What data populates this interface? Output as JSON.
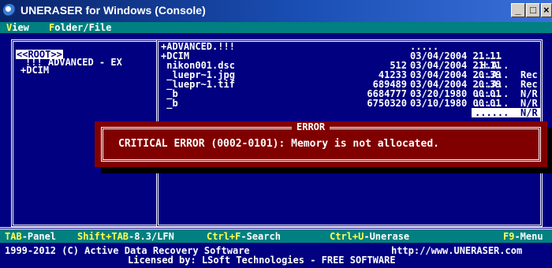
{
  "window": {
    "title": "UNERASER for Windows (Console)",
    "minimize": "_",
    "maximize": "□",
    "close": "×"
  },
  "menu": {
    "view": {
      "hot": "V",
      "rest": "iew"
    },
    "folder_file": {
      "hot": "F",
      "rest": "older/File"
    }
  },
  "left_panel": {
    "root": "<<ROOT>>",
    "items": [
      "!!! ADVANCED - EX",
      "+DCIM"
    ]
  },
  "right_panel": {
    "rows": [
      {
        "name": "+ADVANCED.!!!",
        "size": "",
        "date": ".....",
        "attr": "",
        "flag": ""
      },
      {
        "name": "+DCIM",
        "size": "",
        "date": "03/04/2004 21:11",
        "attr": ".....",
        "flag": ""
      },
      {
        "name": " nikon001.dsc",
        "size": "512",
        "date": "03/04/2004 21:11",
        "attr": ".H.A..",
        "flag": ""
      },
      {
        "name": " _luepr~1.jpg",
        "size": "41233",
        "date": "03/04/2004 20:39",
        "attr": "...A..",
        "flag": "Rec"
      },
      {
        "name": " _luepr~1.tif",
        "size": "689489",
        "date": "03/04/2004 20:39",
        "attr": "...A..",
        "flag": "Rec"
      },
      {
        "name": " _b",
        "size": "6684777",
        "date": "03/20/1980 00:01",
        "attr": "......",
        "flag": "N/R"
      },
      {
        "name": " _b",
        "size": "6750320",
        "date": "03/10/1980 00:01",
        "attr": "......",
        "flag": "N/R"
      },
      {
        "name": "",
        "size": "",
        "date": "",
        "attr": "......",
        "flag": "N/R"
      }
    ]
  },
  "error_dialog": {
    "title": "ERROR",
    "message": "CRITICAL ERROR (0002-0101): Memory is not allocated."
  },
  "helpbar": [
    {
      "key": "TAB",
      "label": "-Panel"
    },
    {
      "key": "Shift+TAB",
      "label": "-8.3/LFN"
    },
    {
      "key": "Ctrl+F",
      "label": "-Search"
    },
    {
      "key": "Ctrl+U",
      "label": "-Unerase"
    },
    {
      "key": "F9",
      "label": "-Menu"
    }
  ],
  "statusbar": {
    "copyright": "1999-2012 (C) Active Data Recovery Software",
    "url": "http://www.UNERASER.com",
    "license": "Licensed by: LSoft Technologies - FREE SOFTWARE"
  },
  "colors": {
    "panel_bg": "#000080",
    "menubar_bg": "#008080",
    "hotkey": "#ffff55",
    "error_bg": "#800000"
  }
}
